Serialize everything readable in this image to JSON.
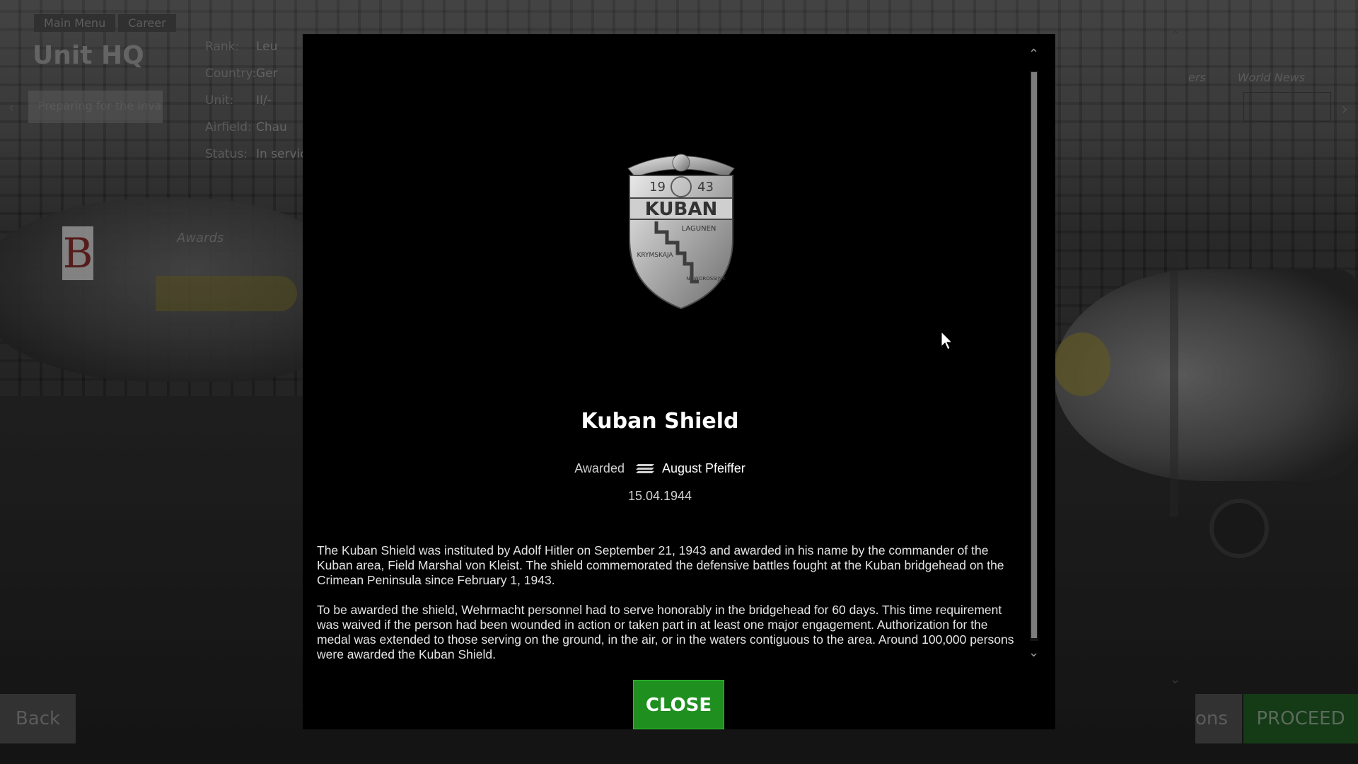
{
  "background": {
    "breadcrumb": [
      "Main Menu",
      "Career"
    ],
    "page_title": "Unit HQ",
    "mission_field": "Preparing for the Inva",
    "info": [
      {
        "label": "Rank:",
        "value": "Leu"
      },
      {
        "label": "Country:",
        "value": "Ger"
      },
      {
        "label": "Unit:",
        "value": "II/-"
      },
      {
        "label": "Airfield:",
        "value": "Chau"
      },
      {
        "label": "Status:",
        "value": "In servic"
      }
    ],
    "awards_label": "Awards",
    "top_right_tabs": [
      "ers",
      "World News"
    ],
    "back_label": "Back",
    "ons_label": "ons",
    "proceed_label": "PROCEED",
    "tail_letter": "B"
  },
  "modal": {
    "title": "Kuban Shield",
    "awarded_prefix": "Awarded",
    "pilot_name": "August Pfeiffer",
    "date": "15.04.1944",
    "description": [
      "The Kuban Shield was instituted by Adolf Hitler on September 21, 1943 and awarded in his name by the commander of the Kuban area, Field Marshal von Kleist. The shield commemorated the defensive battles fought at the Kuban bridgehead on the Crimean Peninsula since February 1, 1943.",
      "To be awarded the shield, Wehrmacht personnel had to serve honorably in the bridgehead for 60 days. This time requirement was waived if the person had been wounded in action or taken part in at least one major engagement. Authorization for the medal was extended to those serving on the ground, in the air, or in the waters contiguous to the area. Around 100,000 persons were awarded the Kuban Shield."
    ],
    "close_label": "CLOSE",
    "medal": {
      "year_left": "19",
      "year_right": "43",
      "banner": "KUBAN",
      "place_1": "LAGUNEN",
      "place_2": "KRYMSKAJA",
      "place_3": "NOWOROSSIJSK"
    }
  },
  "colors": {
    "close_button": "#1f8f1f",
    "proceed_button": "#1f5a22",
    "modal_bg": "#000000"
  }
}
